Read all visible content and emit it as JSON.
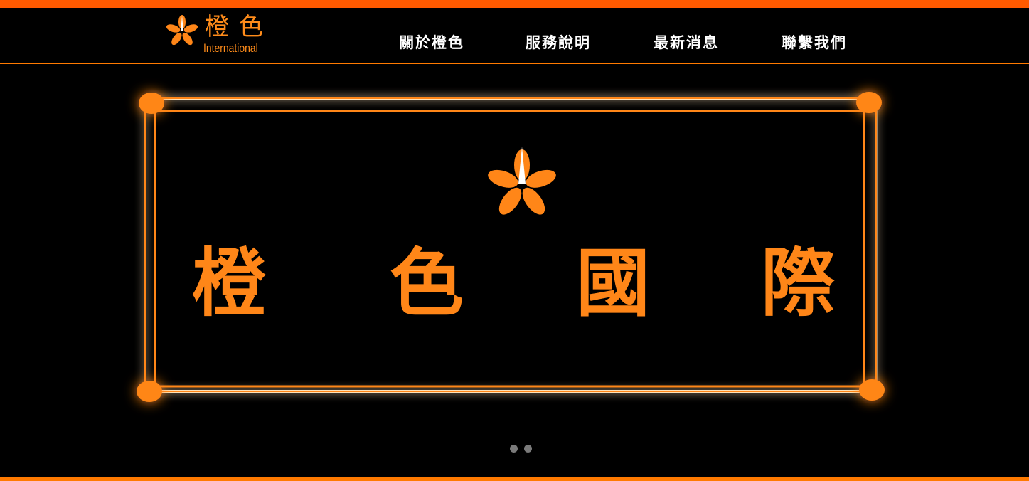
{
  "logo": {
    "chinese": "橙色",
    "english": "International"
  },
  "nav": {
    "items": [
      {
        "label": "關於橙色"
      },
      {
        "label": "服務說明"
      },
      {
        "label": "最新消息"
      },
      {
        "label": "聯繫我們"
      }
    ]
  },
  "hero": {
    "brand_chars": [
      "橙",
      "色",
      "國",
      "際"
    ],
    "emblem": "moon-flower-icon"
  },
  "slider": {
    "dot_count": 2
  },
  "colors": {
    "accent": "#ff5a00",
    "brand_orange": "#ff8618",
    "background": "#000000",
    "nav_text": "#ffffff"
  }
}
